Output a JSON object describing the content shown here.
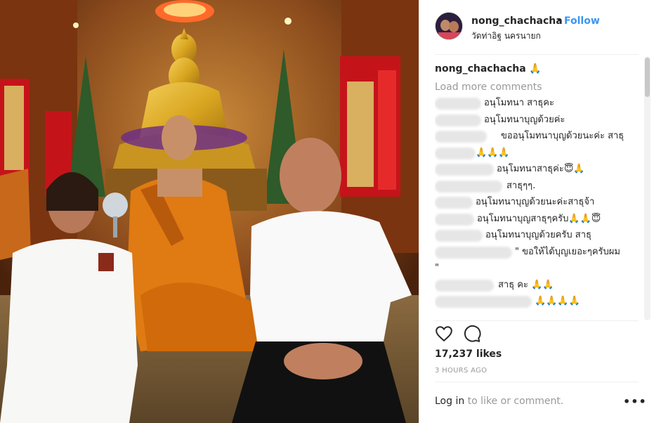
{
  "post": {
    "username": "nong_chachacha",
    "follow_label": "Follow",
    "dot": "•",
    "location": "วัดท่าอิฐ นครนายก",
    "caption_user": "nong_chachacha",
    "caption_text": "🙏",
    "load_more": "Load more comments",
    "comments": [
      {
        "text": "อนุโมทนา สาธุคะ"
      },
      {
        "text": "อนุโมทนาบุญด้วยค่ะ"
      },
      {
        "text": "ขออนุโมทนาบุญด้วยนะค่ะ สาธุ"
      },
      {
        "text": "🙏🙏🙏"
      },
      {
        "text": "อนุโมทนาสาธุค่ะ😇🙏"
      },
      {
        "text": "สาธุๆๆ."
      },
      {
        "text": "อนุโมทนาบุญด้วยนะค่ะสาธุจ้า"
      },
      {
        "text": "อนุโมทนาบุญสาธุๆครับ🙏🙏😇"
      },
      {
        "text": "อนุโมทนาบุญด้วยครับ สาธุ"
      },
      {
        "text": "\" ขอให้ได้บุญเยอะๆครับผม"
      },
      {
        "text": "\""
      },
      {
        "text": "สาธุ คะ 🙏🙏"
      },
      {
        "text": "🙏🙏🙏🙏"
      }
    ],
    "likes": "17,237 likes",
    "time_ago": "3 HOURS AGO",
    "login_link": "Log in",
    "login_rest": " to like or comment.",
    "more_label": "•••"
  },
  "icons": {
    "like": "heart-icon",
    "comment": "comment-bubble-icon",
    "more": "more-options-icon"
  },
  "colors": {
    "link": "#3897f0",
    "text": "#262626",
    "muted": "#999999",
    "robe": "#e07a12",
    "gold": "#d9a520"
  }
}
